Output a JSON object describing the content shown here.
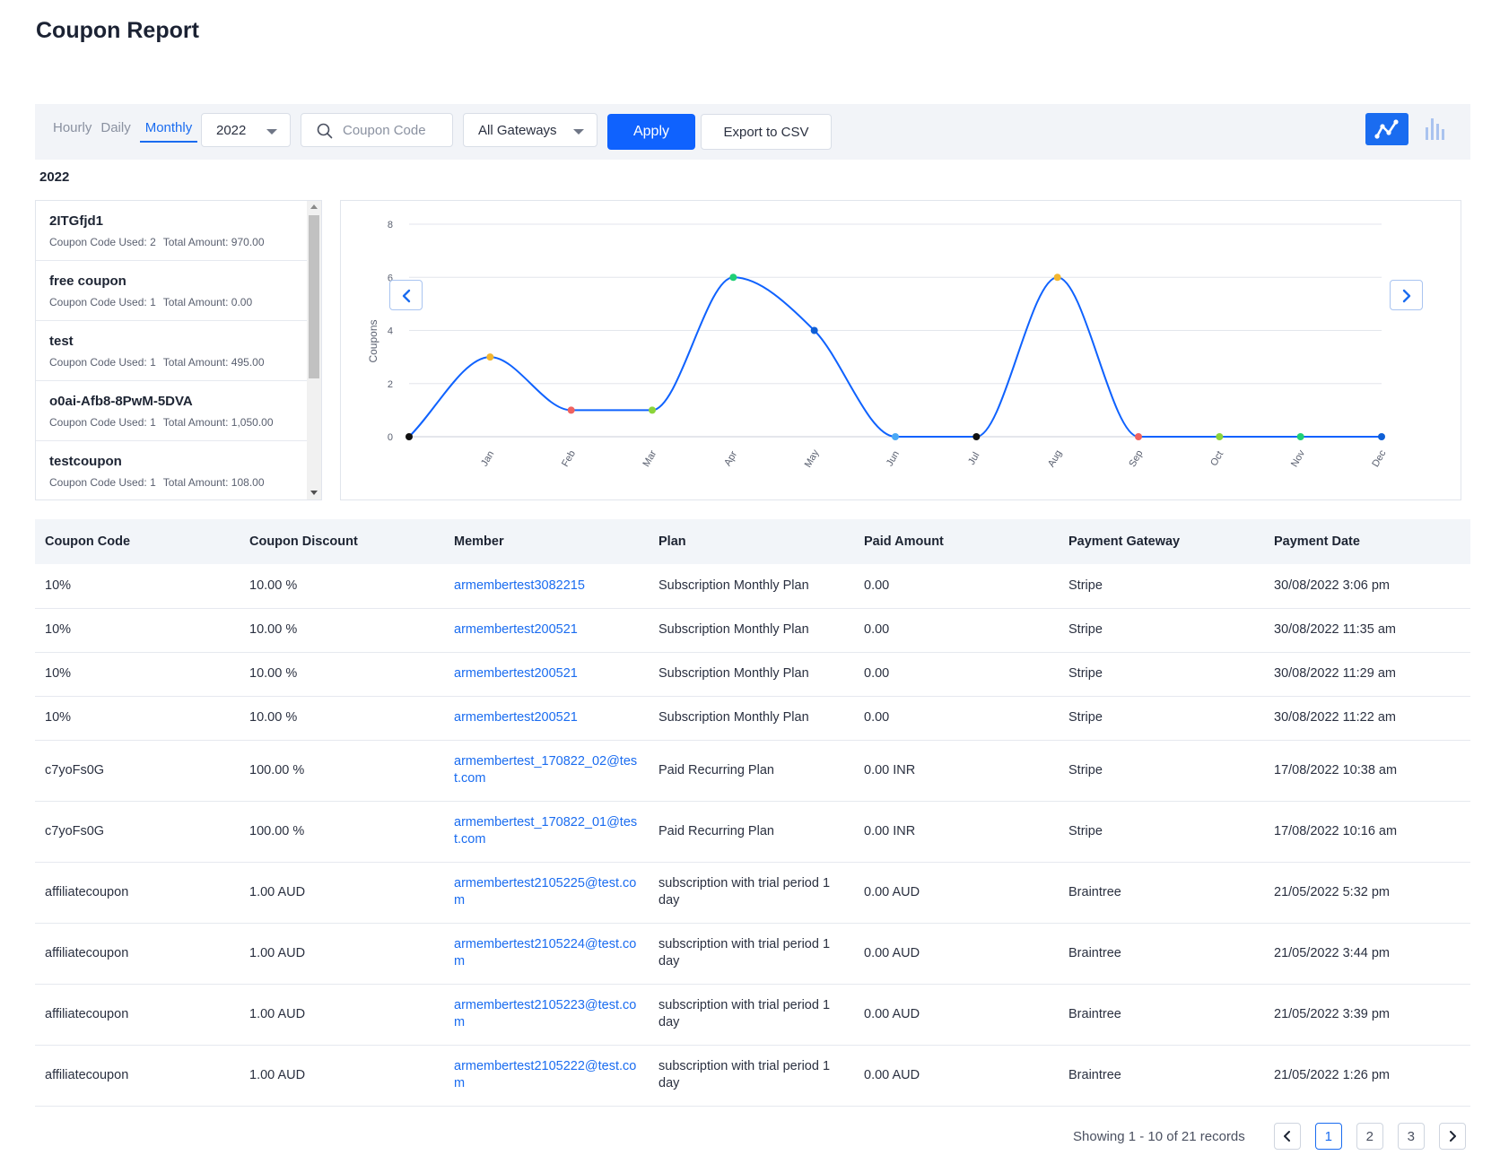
{
  "page": {
    "title": "Coupon Report"
  },
  "filters": {
    "period_tabs": [
      {
        "label": "Hourly",
        "active": false
      },
      {
        "label": "Daily",
        "active": false
      },
      {
        "label": "Monthly",
        "active": true
      }
    ],
    "year": "2022",
    "coupon_placeholder": "Coupon Code",
    "gateway": "All Gateways",
    "apply_label": "Apply",
    "export_label": "Export to CSV",
    "active_view": "line-chart"
  },
  "section_year": "2022",
  "coupon_list": [
    {
      "name": "2ITGfjd1",
      "used_label": "Coupon Code Used: 2",
      "amount_label": "Total Amount: 970.00"
    },
    {
      "name": "free coupon",
      "used_label": "Coupon Code Used: 1",
      "amount_label": "Total Amount: 0.00"
    },
    {
      "name": "test",
      "used_label": "Coupon Code Used: 1",
      "amount_label": "Total Amount: 495.00"
    },
    {
      "name": "o0ai-Afb8-8PwM-5DVA",
      "used_label": "Coupon Code Used: 1",
      "amount_label": "Total Amount: 1,050.00"
    },
    {
      "name": "testcoupon",
      "used_label": "Coupon Code Used: 1",
      "amount_label": "Total Amount: 108.00"
    }
  ],
  "chart_data": {
    "type": "line",
    "ylabel": "Coupons",
    "ylim": [
      0,
      8
    ],
    "yticks": [
      0,
      2,
      4,
      6,
      8
    ],
    "grid": true,
    "categories": [
      "",
      "Jan",
      "Feb",
      "Mar",
      "Apr",
      "May",
      "Jun",
      "Jul",
      "Aug",
      "Sep",
      "Oct",
      "Nov",
      "Dec"
    ],
    "values": [
      0,
      3,
      1,
      1,
      6,
      4,
      0,
      0,
      6,
      0,
      0,
      0,
      0
    ],
    "point_colors": [
      "#111111",
      "#f2b630",
      "#f0625f",
      "#8bd43a",
      "#1fcf76",
      "#0f5fd6",
      "#4aa8f5",
      "#111111",
      "#f2b630",
      "#f0625f",
      "#8bd43a",
      "#1fcf76",
      "#0f5fd6"
    ],
    "line_color": "#0f62fe"
  },
  "table": {
    "headers": [
      "Coupon Code",
      "Coupon Discount",
      "Member",
      "Plan",
      "Paid Amount",
      "Payment Gateway",
      "Payment Date"
    ],
    "rows": [
      {
        "code": "10%",
        "discount": "10.00 %",
        "member": "armembertest3082215",
        "plan": "Subscription Monthly Plan",
        "paid": "0.00",
        "gateway": "Stripe",
        "date": "30/08/2022 3:06 pm"
      },
      {
        "code": "10%",
        "discount": "10.00 %",
        "member": "armembertest200521",
        "plan": "Subscription Monthly Plan",
        "paid": "0.00",
        "gateway": "Stripe",
        "date": "30/08/2022 11:35 am"
      },
      {
        "code": "10%",
        "discount": "10.00 %",
        "member": "armembertest200521",
        "plan": "Subscription Monthly Plan",
        "paid": "0.00",
        "gateway": "Stripe",
        "date": "30/08/2022 11:29 am"
      },
      {
        "code": "10%",
        "discount": "10.00 %",
        "member": "armembertest200521",
        "plan": "Subscription Monthly Plan",
        "paid": "0.00",
        "gateway": "Stripe",
        "date": "30/08/2022 11:22 am"
      },
      {
        "code": "c7yoFs0G",
        "discount": "100.00 %",
        "member": "armembertest_170822_02@test.com",
        "plan": "Paid Recurring Plan",
        "paid": "0.00 INR",
        "gateway": "Stripe",
        "date": "17/08/2022 10:38 am"
      },
      {
        "code": "c7yoFs0G",
        "discount": "100.00 %",
        "member": "armembertest_170822_01@test.com",
        "plan": "Paid Recurring Plan",
        "paid": "0.00 INR",
        "gateway": "Stripe",
        "date": "17/08/2022 10:16 am"
      },
      {
        "code": "affiliatecoupon",
        "discount": "1.00 AUD",
        "member": "armembertest2105225@test.com",
        "plan": "subscription with trial period 1 day",
        "paid": "0.00 AUD",
        "gateway": "Braintree",
        "date": "21/05/2022 5:32 pm"
      },
      {
        "code": "affiliatecoupon",
        "discount": "1.00 AUD",
        "member": "armembertest2105224@test.com",
        "plan": "subscription with trial period 1 day",
        "paid": "0.00 AUD",
        "gateway": "Braintree",
        "date": "21/05/2022 3:44 pm"
      },
      {
        "code": "affiliatecoupon",
        "discount": "1.00 AUD",
        "member": "armembertest2105223@test.com",
        "plan": "subscription with trial period 1 day",
        "paid": "0.00 AUD",
        "gateway": "Braintree",
        "date": "21/05/2022 3:39 pm"
      },
      {
        "code": "affiliatecoupon",
        "discount": "1.00 AUD",
        "member": "armembertest2105222@test.com",
        "plan": "subscription with trial period 1 day",
        "paid": "0.00 AUD",
        "gateway": "Braintree",
        "date": "21/05/2022 1:26 pm"
      }
    ]
  },
  "pagination": {
    "records_text": "Showing 1 - 10 of 21 records",
    "pages": [
      "1",
      "2",
      "3"
    ],
    "current": "1"
  }
}
